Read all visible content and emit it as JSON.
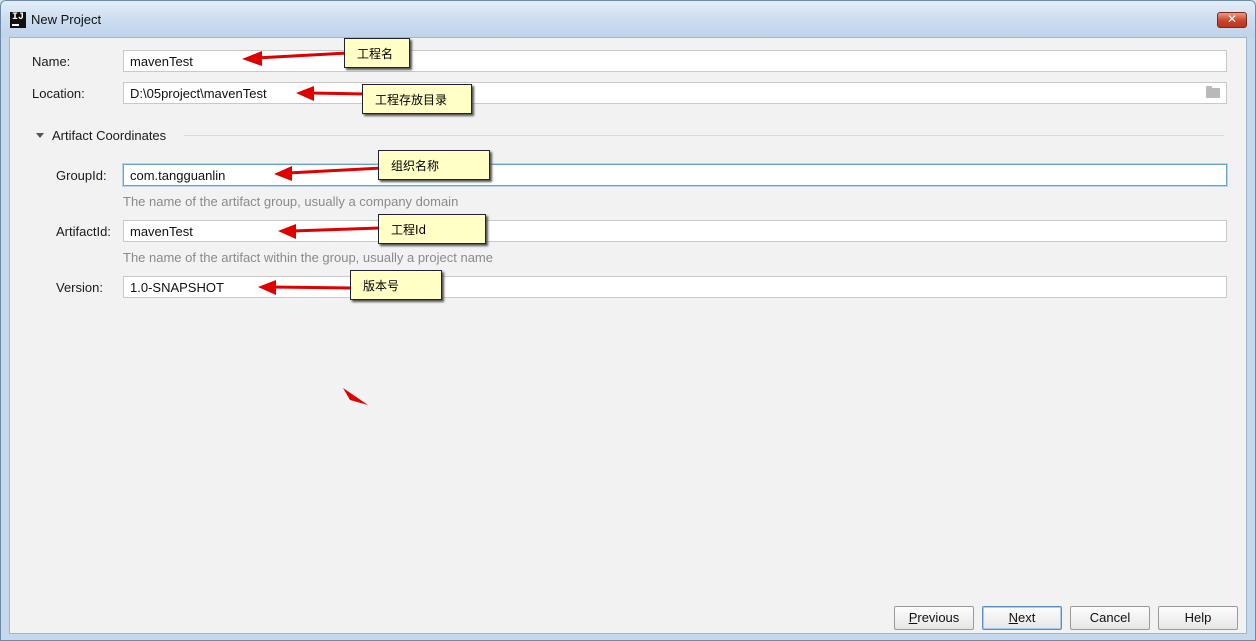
{
  "window": {
    "title": "New Project",
    "app_icon_label": "IJ",
    "close_label": "✕"
  },
  "form": {
    "name": {
      "label": "Name:",
      "value": "mavenTest"
    },
    "location": {
      "label": "Location:",
      "value": "D:\\05project\\mavenTest",
      "browse_icon": "folder-icon"
    },
    "artifact_section": {
      "title": "Artifact Coordinates",
      "expanded": true
    },
    "group_id": {
      "label": "GroupId:",
      "value": "com.tangguanlin",
      "hint": "The name of the artifact group, usually a company domain"
    },
    "artifact_id": {
      "label": "ArtifactId:",
      "value": "mavenTest",
      "hint": "The name of the artifact within the group, usually a project name"
    },
    "version": {
      "label": "Version:",
      "value": "1.0-SNAPSHOT"
    }
  },
  "annotations": {
    "name_note": "工程名",
    "location_note": "工程存放目录",
    "group_note": "组织名称",
    "artifact_note": "工程Id",
    "version_note": "版本号"
  },
  "buttons": {
    "previous": {
      "mnemonic": "P",
      "rest": "revious"
    },
    "next": {
      "mnemonic": "N",
      "rest": "ext"
    },
    "cancel": "Cancel",
    "help": "Help"
  },
  "colors": {
    "arrow": "#e00000",
    "callout_bg": "#ffffc6",
    "focus_border": "#6aa3c8"
  }
}
